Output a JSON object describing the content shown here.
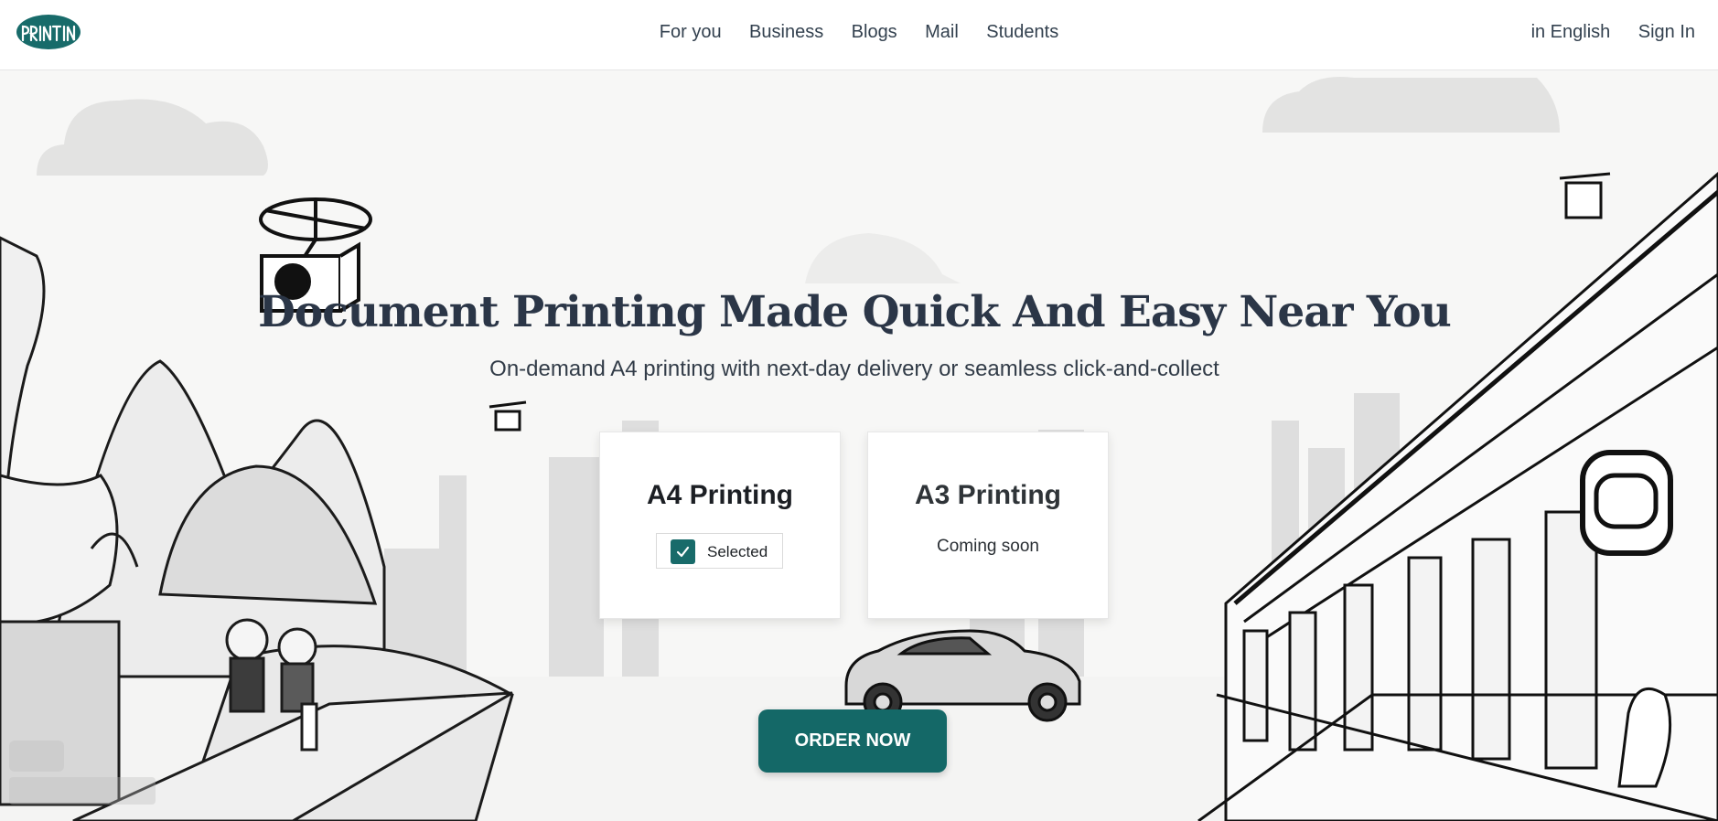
{
  "brand": {
    "logo_text": "PRINTIN",
    "accent_color": "#146867"
  },
  "nav": {
    "items": [
      {
        "label": "For you"
      },
      {
        "label": "Business"
      },
      {
        "label": "Blogs"
      },
      {
        "label": "Mail"
      },
      {
        "label": "Students"
      }
    ],
    "language": "in English",
    "sign_in": "Sign In"
  },
  "hero": {
    "title": "Document Printing Made Quick And Easy Near You",
    "subtitle": "On-demand A4 printing with next-day delivery or seamless click-and-collect",
    "options": [
      {
        "label": "A4 Printing",
        "status": "Selected",
        "selected": true
      },
      {
        "label": "A3 Printing",
        "status": "Coming soon",
        "selected": false
      }
    ],
    "cta": "ORDER NOW"
  }
}
